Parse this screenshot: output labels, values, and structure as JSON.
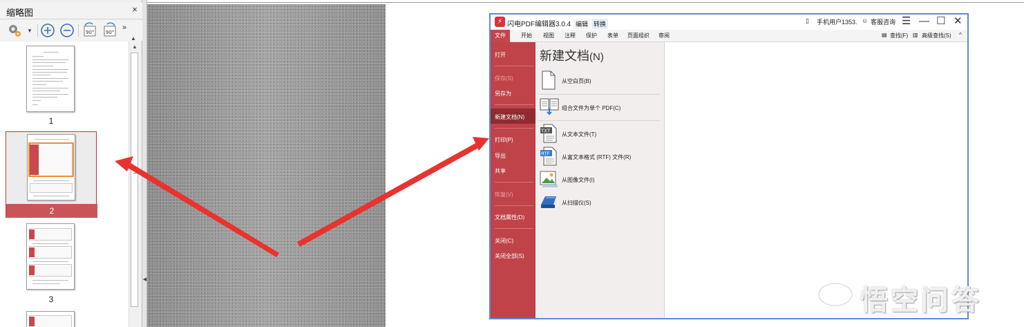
{
  "thumbnail_panel": {
    "title": "缩略图",
    "close_glyph": "×",
    "toolbar": {
      "options_icon": "gear-icon",
      "zoom_in_icon": "zoom-in-icon",
      "zoom_out_icon": "zoom-out-icon",
      "rotate_ccw_label": "90°",
      "rotate_cw_label": "90°",
      "more_glyph": "»"
    },
    "pages": [
      {
        "number": "1",
        "selected": false
      },
      {
        "number": "2",
        "selected": true
      },
      {
        "number": "3",
        "selected": false
      },
      {
        "number": "",
        "selected": false
      }
    ]
  },
  "app_window": {
    "title": "闪电PDF编辑器3.0.4",
    "logo_glyph": "⚡",
    "context_tabs": {
      "edit": "编辑",
      "convert": "转换"
    },
    "user": "手机用户1353.",
    "support": "客服咨询",
    "window_controls": {
      "menu": "☰",
      "minimize": "—",
      "maximize": "☐",
      "close": "✕"
    },
    "ribbon_tabs": [
      "文件",
      "开始",
      "视图",
      "注释",
      "保护",
      "表单",
      "页面组织",
      "审阅"
    ],
    "ribbon_right": {
      "find": "查找(F)",
      "advanced_find": "高级查找(S)",
      "collapse": "^"
    },
    "file_menu": [
      {
        "label": "打开",
        "enabled": true
      },
      {
        "label": "保存(S)",
        "enabled": false
      },
      {
        "label": "另存为",
        "enabled": true
      },
      {
        "label": "新建文档(N)",
        "enabled": true,
        "selected": true
      },
      {
        "label": "打印(P)",
        "enabled": true
      },
      {
        "label": "导出",
        "enabled": true
      },
      {
        "label": "共享",
        "enabled": true
      },
      {
        "label": "恢复(V)",
        "enabled": false
      },
      {
        "label": "文档属性(D)",
        "enabled": true
      },
      {
        "label": "关闭(C)",
        "enabled": true
      },
      {
        "label": "关闭全部(S)",
        "enabled": true
      }
    ],
    "new_document": {
      "title": "新建文档",
      "title_suffix": "(N)",
      "options": [
        {
          "label": "从空白页(B)",
          "icon": "blank-page-icon"
        },
        {
          "label": "组合文件为单个 PDF(C)",
          "icon": "combine-files-icon"
        },
        {
          "label": "从文本文件(T)",
          "icon": "txt-file-icon"
        },
        {
          "label": "从富文本格式 (RTF) 文件(R)",
          "icon": "rtf-file-icon"
        },
        {
          "label": "从图像文件(I)",
          "icon": "image-file-icon"
        },
        {
          "label": "从扫描仪(S)",
          "icon": "scanner-icon"
        }
      ]
    }
  },
  "watermark": {
    "text": "悟空问答"
  },
  "colors": {
    "accent_red": "#c3464c",
    "annotation_arrow": "#e8332f",
    "window_border": "#5b8bd6"
  }
}
